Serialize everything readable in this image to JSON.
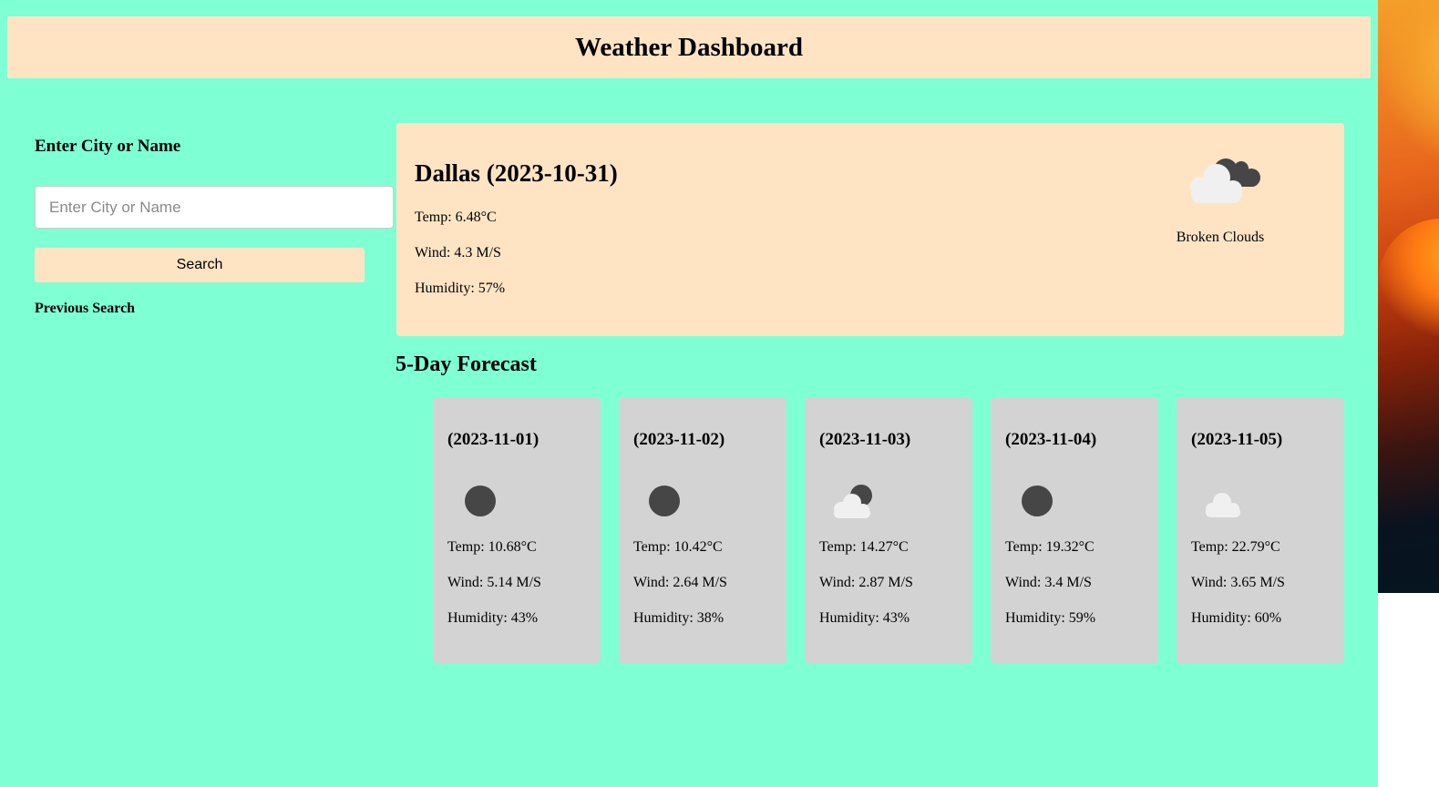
{
  "header": {
    "title": "Weather Dashboard"
  },
  "search": {
    "heading": "Enter City or Name",
    "placeholder": "Enter City or Name",
    "value": "",
    "button_label": "Search",
    "previous_heading": "Previous Search"
  },
  "current": {
    "title": "Dallas (2023-10-31)",
    "temp": "Temp: 6.48°C",
    "wind": "Wind: 4.3 M/S",
    "humidity": "Humidity: 57%",
    "description": "Broken Clouds",
    "icon": "broken-clouds-icon"
  },
  "forecast": {
    "heading": "5-Day Forecast",
    "days": [
      {
        "date": "(2023-11-01)",
        "icon": "dark-circle-icon",
        "temp": "Temp: 10.68°C",
        "wind": "Wind: 5.14 M/S",
        "humidity": "Humidity: 43%"
      },
      {
        "date": "(2023-11-02)",
        "icon": "dark-circle-icon",
        "temp": "Temp: 10.42°C",
        "wind": "Wind: 2.64 M/S",
        "humidity": "Humidity: 38%"
      },
      {
        "date": "(2023-11-03)",
        "icon": "few-clouds-icon",
        "temp": "Temp: 14.27°C",
        "wind": "Wind: 2.87 M/S",
        "humidity": "Humidity: 43%"
      },
      {
        "date": "(2023-11-04)",
        "icon": "dark-circle-icon",
        "temp": "Temp: 19.32°C",
        "wind": "Wind: 3.4 M/S",
        "humidity": "Humidity: 59%"
      },
      {
        "date": "(2023-11-05)",
        "icon": "white-cloud-icon",
        "temp": "Temp: 22.79°C",
        "wind": "Wind: 3.65 M/S",
        "humidity": "Humidity: 60%"
      }
    ]
  },
  "colors": {
    "page_background": "#7fffd4",
    "panel_background": "#ffe4c4",
    "forecast_card_background": "#d3d3d3",
    "icon_dark": "#464646",
    "icon_light": "#f0f0f0"
  }
}
